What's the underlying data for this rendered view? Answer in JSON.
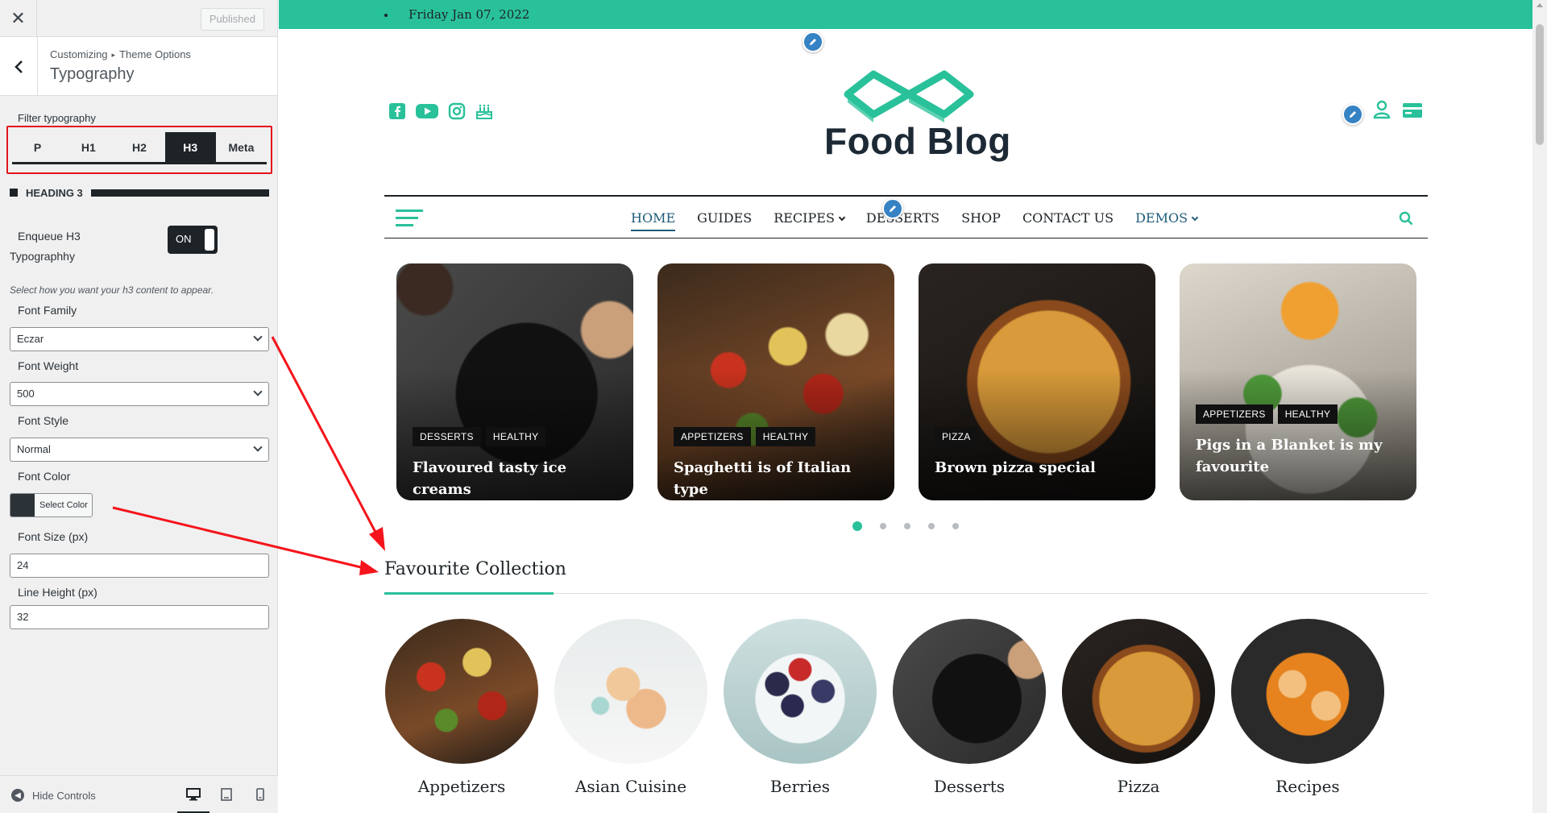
{
  "sidebar": {
    "close_icon": "close-icon",
    "published_label": "Published",
    "breadcrumb": {
      "first": "Customizing",
      "separator": "▸",
      "second": "Theme Options"
    },
    "title": "Typography",
    "filter_label": "Filter typography",
    "filter_tabs": [
      "P",
      "H1",
      "H2",
      "H3",
      "Meta"
    ],
    "filter_active": "H3",
    "section_heading": "HEADING 3",
    "enqueue_label": "Enqueue H3 Typographhy",
    "enqueue_toggle": "ON",
    "help_text": "Select how you want your h3 content to appear.",
    "font_family_label": "Font Family",
    "font_family_value": "Eczar",
    "font_weight_label": "Font Weight",
    "font_weight_value": "500",
    "font_style_label": "Font Style",
    "font_style_value": "Normal",
    "font_color_label": "Font Color",
    "font_color_button": "Select Color",
    "font_color_swatch": "#2c3338",
    "font_size_label": "Font Size (px)",
    "font_size_value": "24",
    "line_height_label": "Line Height (px)",
    "line_height_value": "32",
    "hide_controls": "Hide Controls"
  },
  "preview": {
    "accent_color": "#29c19a",
    "top_date": "Friday Jan 07, 2022",
    "social_icons": [
      "facebook-icon",
      "youtube-icon",
      "instagram-icon",
      "birthday-cake-icon"
    ],
    "logo_text": "Food Blog",
    "nav_items": [
      {
        "label": "HOME"
      },
      {
        "label": "GUIDES"
      },
      {
        "label": "RECIPES"
      },
      {
        "label": "DESSERTS"
      },
      {
        "label": "SHOP"
      },
      {
        "label": "CONTACT US"
      },
      {
        "label": "DEMOS"
      }
    ],
    "slider_cards": [
      {
        "tags": [
          "DESSERTS",
          "HEALTHY"
        ],
        "title": "Flavoured tasty ice creams"
      },
      {
        "tags": [
          "APPETIZERS",
          "HEALTHY"
        ],
        "title": "Spaghetti is of Italian type"
      },
      {
        "tags": [
          "PIZZA"
        ],
        "title": "Brown pizza special"
      },
      {
        "tags": [
          "APPETIZERS",
          "HEALTHY"
        ],
        "title": "Pigs in a Blanket is my favourite"
      }
    ],
    "slider_dots_total": 5,
    "slider_dot_active": 1,
    "section_title": "Favourite Collection",
    "categories": [
      "Appetizers",
      "Asian Cuisine",
      "Berries",
      "Desserts",
      "Pizza",
      "Recipes"
    ]
  }
}
